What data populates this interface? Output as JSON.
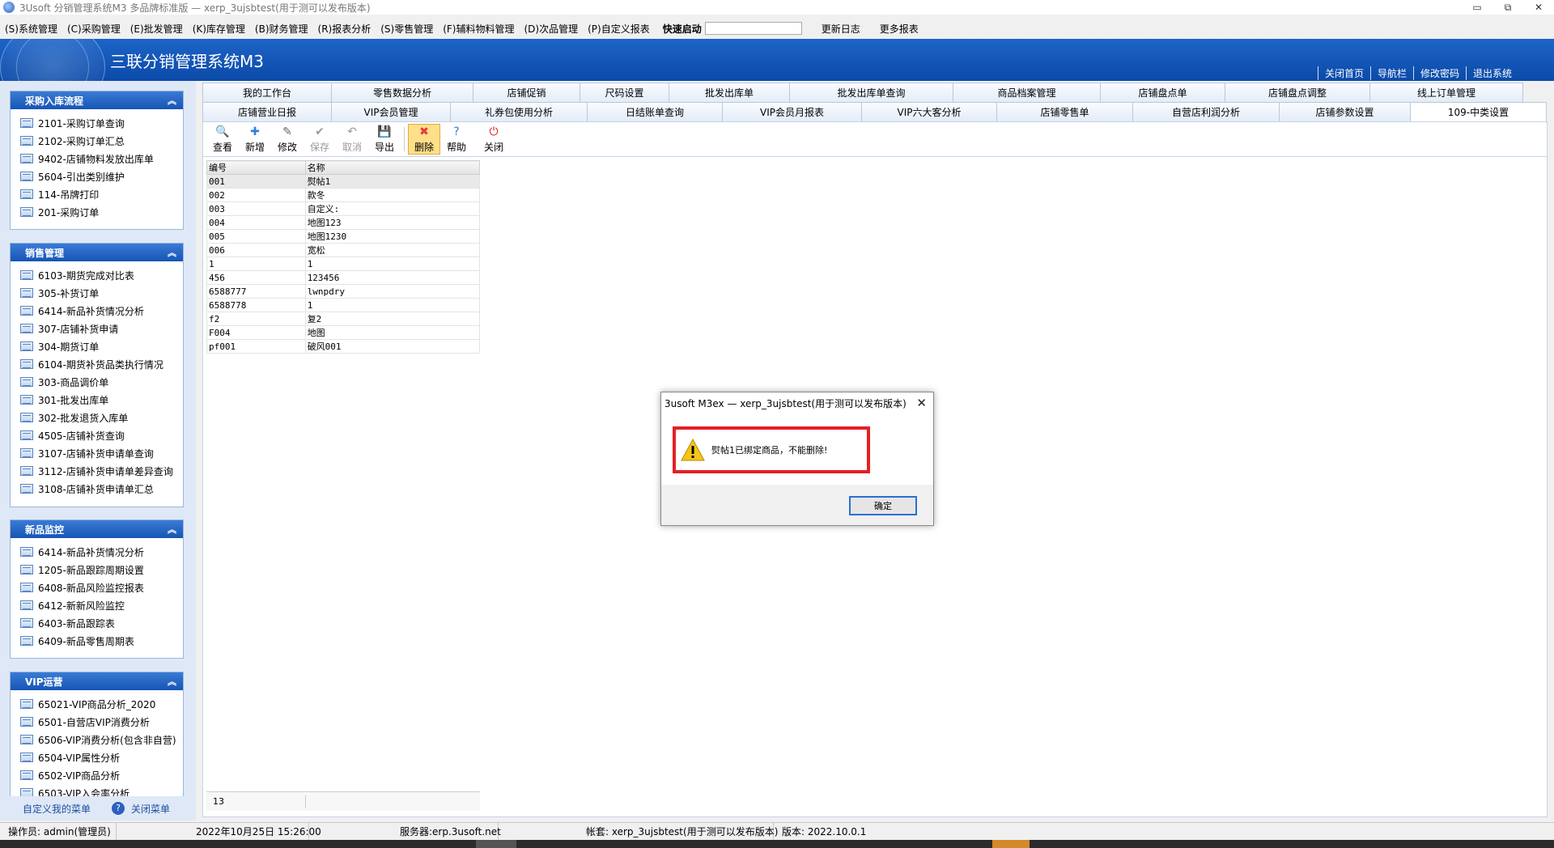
{
  "window": {
    "title": "3Usoft 分销管理系统M3 多品牌标准版 — xerp_3ujsbtest(用于测可以发布版本)",
    "min_glyph": "▭",
    "restore_glyph": "⧉",
    "close_glyph": "✕"
  },
  "menu": {
    "items": [
      "(S)系统管理",
      "(C)采购管理",
      "(E)批发管理",
      "(K)库存管理",
      "(B)财务管理",
      "(R)报表分析",
      "(S)零售管理",
      "(F)辅料物料管理",
      "(D)次品管理",
      "(P)自定义报表"
    ],
    "quick_label": "快速启动",
    "quick_value": "",
    "extra": [
      "更新日志",
      "更多报表"
    ]
  },
  "banner": {
    "title": "三联分销管理系统M3",
    "links": [
      "关闭首页",
      "导航栏",
      "修改密码",
      "退出系统"
    ]
  },
  "sidebar": {
    "panels": [
      {
        "title": "采购入库流程",
        "collapse": "︽",
        "items": [
          "2101-采购订单查询",
          "2102-采购订单汇总",
          "9402-店铺物料发放出库单",
          "5604-引出类别维护",
          "114-吊牌打印",
          "201-采购订单"
        ]
      },
      {
        "title": "销售管理",
        "collapse": "︽",
        "items": [
          "6103-期货完成对比表",
          "305-补货订单",
          "6414-新品补货情况分析",
          "307-店铺补货申请",
          "304-期货订单",
          "6104-期货补货品类执行情况",
          "303-商品调价单",
          "301-批发出库单",
          "302-批发退货入库单",
          "4505-店铺补货查询",
          "3107-店铺补货申请单查询",
          "3112-店铺补货申请单差异查询",
          "3108-店铺补货申请单汇总"
        ]
      },
      {
        "title": "新品监控",
        "collapse": "︽",
        "items": [
          "6414-新品补货情况分析",
          "1205-新品跟踪周期设置",
          "6408-新品风险监控报表",
          "6412-新新风险监控",
          "6403-新品跟踪表",
          "6409-新品零售周期表"
        ]
      },
      {
        "title": "VIP运营",
        "collapse": "︽",
        "items": [
          "65021-VIP商品分析_2020",
          "6501-自营店VIP消费分析",
          "6506-VIP消费分析(包含非自营)",
          "6504-VIP属性分析",
          "6502-VIP商品分析",
          "6503-VIP入会率分析"
        ]
      }
    ],
    "footer": {
      "custom_menu": "自定义我的菜单",
      "help_glyph": "?",
      "close_menu": "关闭菜单"
    }
  },
  "tabs": {
    "row1": [
      "我的工作台",
      "零售数据分析",
      "店铺促销",
      "尺码设置",
      "批发出库单",
      "批发出库单查询",
      "商品档案管理",
      "店铺盘点单",
      "店铺盘点调整",
      "线上订单管理"
    ],
    "row2": [
      "店铺营业日报",
      "VIP会员管理",
      "礼券包使用分析",
      "日结账单查询",
      "VIP会员月报表",
      "VIP六大客分析",
      "店铺零售单",
      "自营店利润分析",
      "店铺参数设置",
      "109-中类设置"
    ],
    "active": "109-中类设置"
  },
  "toolbar": {
    "buttons": [
      {
        "label": "查看",
        "glyph": "🔍",
        "disabled": false
      },
      {
        "label": "新增",
        "glyph": "✚",
        "disabled": false
      },
      {
        "label": "修改",
        "glyph": "✎",
        "disabled": false
      },
      {
        "label": "保存",
        "glyph": "✔",
        "disabled": true
      },
      {
        "label": "取消",
        "glyph": "↶",
        "disabled": true
      },
      {
        "label": "导出",
        "glyph": "💾",
        "disabled": false
      },
      {
        "label": "删除",
        "glyph": "✖",
        "disabled": false,
        "highlight": true
      },
      {
        "label": "帮助",
        "glyph": "?",
        "disabled": false
      },
      {
        "label": "关闭",
        "glyph": "⏻",
        "disabled": false
      }
    ]
  },
  "grid": {
    "columns": [
      "编号",
      "名称"
    ],
    "rows": [
      [
        "001",
        "熨帖1"
      ],
      [
        "002",
        "款冬"
      ],
      [
        "003",
        "自定义:"
      ],
      [
        "004",
        "地图123"
      ],
      [
        "005",
        "地图1230"
      ],
      [
        "006",
        "宽松"
      ],
      [
        "1",
        "1"
      ],
      [
        "456",
        "123456"
      ],
      [
        "6588777",
        "lwnpdry"
      ],
      [
        "6588778",
        "1"
      ],
      [
        "f2",
        "复2"
      ],
      [
        "F004",
        "地图"
      ],
      [
        "pf001",
        "破风001"
      ]
    ],
    "count": "13"
  },
  "dialog": {
    "title": "3usoft M3ex — xerp_3ujsbtest(用于测可以发布版本)",
    "close_glyph": "✕",
    "message": "熨帖1已绑定商品，不能删除!",
    "ok_label": "确定"
  },
  "statusbar": {
    "operator": "操作员: admin(管理员)",
    "datetime": "2022年10月25日 15:26:00",
    "server": "服务器:erp.3usoft.net",
    "account": "帐套: xerp_3ujsbtest(用于测可以发布版本)",
    "version": "版本: 2022.10.0.1"
  },
  "colors": {
    "banner": "#1660c4",
    "panel_header": "#2464c4",
    "alert_border": "#e51f26",
    "highlight": "#ffdf8a"
  }
}
